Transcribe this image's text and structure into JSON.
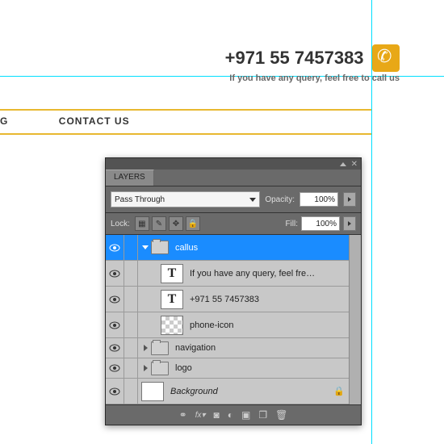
{
  "guides": {
    "v": 460,
    "h": 94
  },
  "header": {
    "phone": "+971 55 7457383",
    "tagline": "If you have any query, feel free to call us"
  },
  "nav": {
    "items": [
      "G",
      "CONTACT US"
    ]
  },
  "panel": {
    "tab": "LAYERS",
    "blend_mode": "Pass Through",
    "opacity_label": "Opacity:",
    "opacity_value": "100%",
    "lock_label": "Lock:",
    "fill_label": "Fill:",
    "fill_value": "100%",
    "layers": [
      {
        "name": "callus",
        "type": "folder",
        "selected": true,
        "expanded": true,
        "indent": 0
      },
      {
        "name": "If you have any query, feel free ...",
        "type": "text",
        "indent": 1
      },
      {
        "name": "+971 55 7457383",
        "type": "text",
        "indent": 1
      },
      {
        "name": "phone-icon",
        "type": "bitmap",
        "indent": 1
      },
      {
        "name": "navigation",
        "type": "folder",
        "expanded": false,
        "indent": 0
      },
      {
        "name": "logo",
        "type": "folder",
        "expanded": false,
        "indent": 0
      },
      {
        "name": "Background",
        "type": "bg",
        "locked": true,
        "italic": true,
        "indent": 0
      }
    ],
    "footer_icons": [
      "link",
      "fx",
      "mask",
      "adj",
      "group",
      "new",
      "trash"
    ]
  }
}
